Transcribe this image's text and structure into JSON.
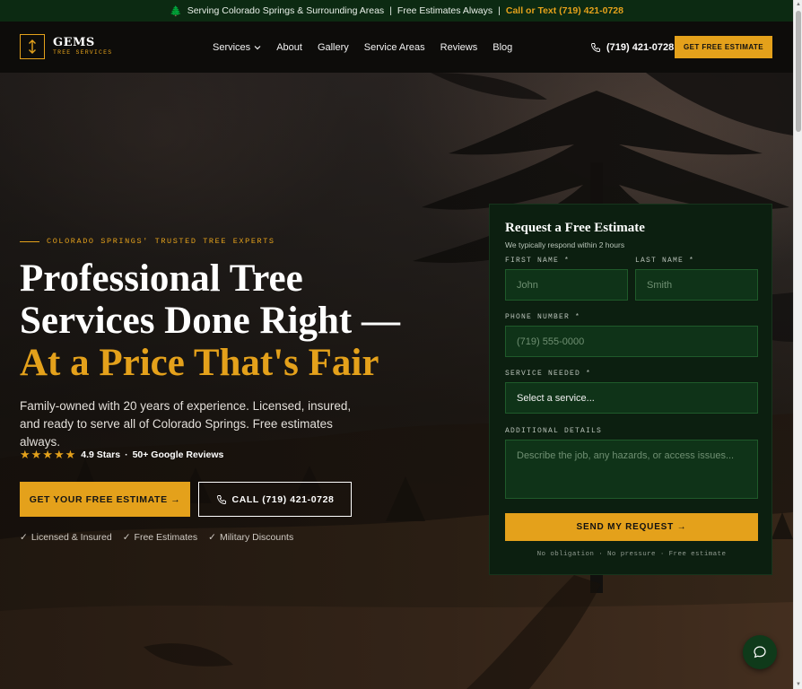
{
  "topbar": {
    "service_area": "Serving Colorado Springs & Surrounding Areas",
    "separator": "|",
    "estimates": "Free Estimates Always",
    "call_text": "Call or Text (719) 421-0728"
  },
  "header": {
    "logo_name": "GEMS",
    "logo_sub": "TREE SERVICES",
    "nav": [
      {
        "label": "Services",
        "has_dropdown": true
      },
      {
        "label": "About"
      },
      {
        "label": "Gallery"
      },
      {
        "label": "Service Areas"
      },
      {
        "label": "Reviews"
      },
      {
        "label": "Blog"
      }
    ],
    "phone": "(719) 421-0728",
    "cta": "GET FREE ESTIMATE"
  },
  "hero": {
    "eyebrow": "COLORADO SPRINGS' TRUSTED TREE EXPERTS",
    "headline_line1": "Professional Tree",
    "headline_line2": "Services Done Right —",
    "headline_accent": "At a Price That's Fair",
    "subcopy": "Family-owned with 20 years of experience. Licensed, insured, and ready to serve all of Colorado Springs. Free estimates always.",
    "stars": "★★★★★",
    "rating_text": "4.9 Stars",
    "rating_dot": "·",
    "reviews_text": "50+ Google Reviews",
    "primary_cta": "GET YOUR FREE ESTIMATE →",
    "secondary_cta": "CALL (719) 421-0728",
    "trust": [
      "Licensed & Insured",
      "Free Estimates",
      "Military Discounts"
    ],
    "check": "✓"
  },
  "form": {
    "title": "Request a Free Estimate",
    "subtitle": "We typically respond within 2 hours",
    "first_name_label": "FIRST NAME *",
    "first_name_placeholder": "John",
    "last_name_label": "LAST NAME *",
    "last_name_placeholder": "Smith",
    "phone_label": "PHONE NUMBER *",
    "phone_placeholder": "(719) 555-0000",
    "service_label": "SERVICE NEEDED *",
    "service_selected": "Select a service...",
    "details_label": "ADDITIONAL DETAILS",
    "details_placeholder": "Describe the job, any hazards, or access issues...",
    "submit": "SEND MY REQUEST →",
    "fine_print": "No obligation · No pressure · Free estimate"
  },
  "colors": {
    "accent": "#e4a11b",
    "dark_green": "#0c2a12",
    "form_bg": "#0c1f10",
    "field_bg": "#0f3318"
  },
  "icons": {
    "topbar": "tree-icon",
    "phone": "phone-icon",
    "chat": "chat-bubble-icon",
    "dropdown": "chevron-down-icon"
  }
}
